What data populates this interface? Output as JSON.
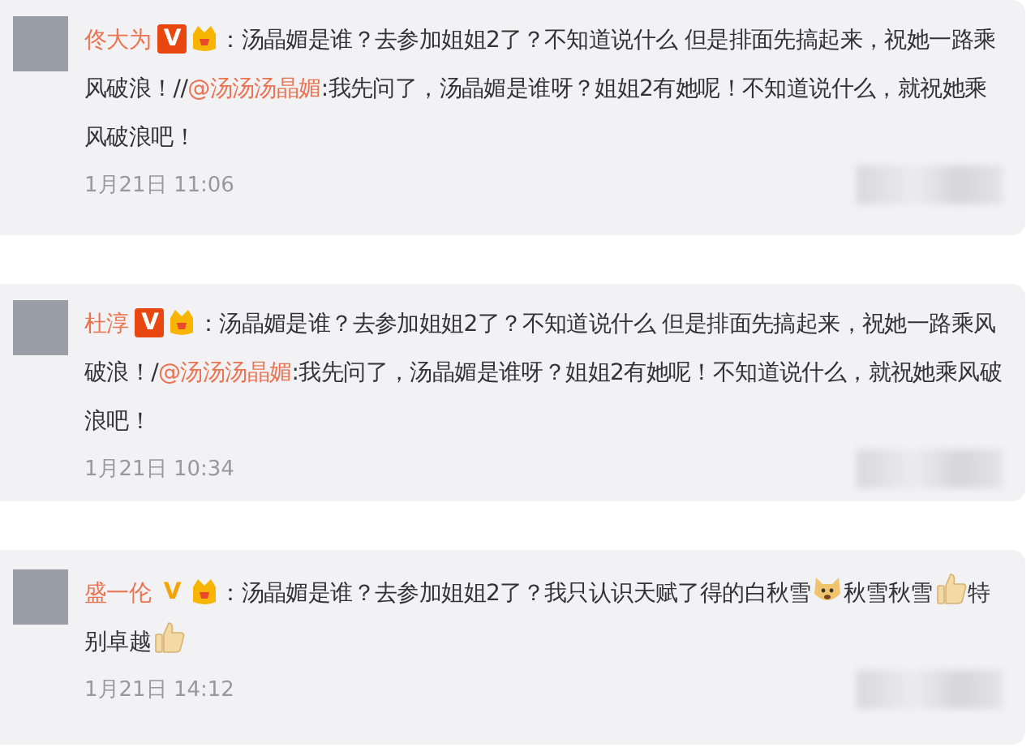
{
  "comments": [
    {
      "name": "佟大为",
      "badge": {
        "text": "V",
        "boxed": true
      },
      "segments": [
        {
          "kind": "text",
          "text": "：汤晶媚是谁？去参加姐姐2了？不知道说什么 但是排面先搞起来，祝她一路乘风破浪！//"
        },
        {
          "kind": "mention",
          "text": "@汤汤汤晶媚"
        },
        {
          "kind": "text",
          "text": ":我先问了，汤晶媚是谁呀？姐姐2有她呢！不知道说什么，就祝她乘风破浪吧！"
        }
      ],
      "time": "1月21日 11:06"
    },
    {
      "name": "杜淳",
      "badge": {
        "text": "V",
        "boxed": true
      },
      "segments": [
        {
          "kind": "text",
          "text": "：汤晶媚是谁？去参加姐姐2了？不知道说什么 但是排面先搞起来，祝她一路乘风破浪！/"
        },
        {
          "kind": "mention",
          "text": "@汤汤汤晶媚"
        },
        {
          "kind": "text",
          "text": ":我先问了，汤晶媚是谁呀？姐姐2有她呢！不知道说什么，就祝她乘风破浪吧！"
        }
      ],
      "time": "1月21日 10:34"
    },
    {
      "name": "盛一伦",
      "badge": {
        "text": "V",
        "boxed": false
      },
      "segments": [
        {
          "kind": "text",
          "text": "：汤晶媚是谁？去参加姐姐2了？我只认识天赋了得的白秋雪"
        },
        {
          "kind": "face"
        },
        {
          "kind": "text",
          "text": "秋雪秋雪"
        },
        {
          "kind": "thumb"
        },
        {
          "kind": "text",
          "text": "特别卓越"
        },
        {
          "kind": "thumb"
        }
      ],
      "time": "1月21日 14:12"
    }
  ]
}
